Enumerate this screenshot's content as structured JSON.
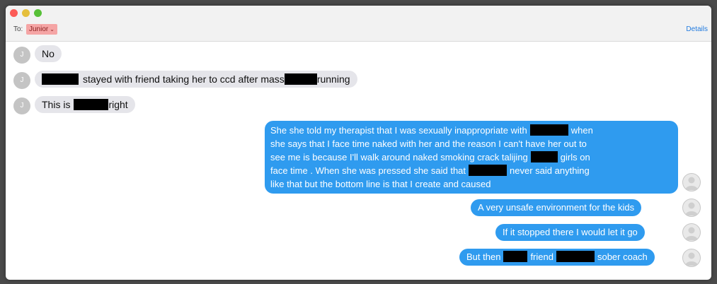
{
  "header": {
    "to_label": "To:",
    "recipient": "Junior",
    "details_label": "Details"
  },
  "contact_avatar_initial": "J",
  "messages_in": [
    {
      "parts": [
        "No"
      ]
    },
    {
      "parts": [
        "",
        "stayed with friend taking her to ccd after mass",
        "running"
      ]
    },
    {
      "parts": [
        "This is",
        "right"
      ]
    }
  ],
  "messages_out": [
    {
      "lines": [
        {
          "parts": [
            "She she told my therapist that I was sexually inappropriate with",
            "when"
          ]
        },
        {
          "parts": [
            "she says that I face time naked with her and the reason I can't have her out to"
          ]
        },
        {
          "parts": [
            "see me is because I'll walk around naked smoking crack talijing",
            "girls on"
          ]
        },
        {
          "parts": [
            "face time . When she was pressed she said that",
            "never said anything"
          ]
        },
        {
          "parts": [
            "like that but the bottom line is that I create and caused"
          ]
        }
      ]
    },
    {
      "parts": [
        "A very unsafe environment for the kids"
      ]
    },
    {
      "parts": [
        "If it stopped there I would let it go"
      ]
    },
    {
      "parts": [
        "But then",
        "friend",
        "sober coach"
      ]
    }
  ],
  "colors": {
    "incoming_bubble": "#e5e5ea",
    "outgoing_bubble": "#2f9bef",
    "recipient_chip": "#f5a5a5",
    "link": "#1f7adf",
    "redaction": "#000000"
  }
}
